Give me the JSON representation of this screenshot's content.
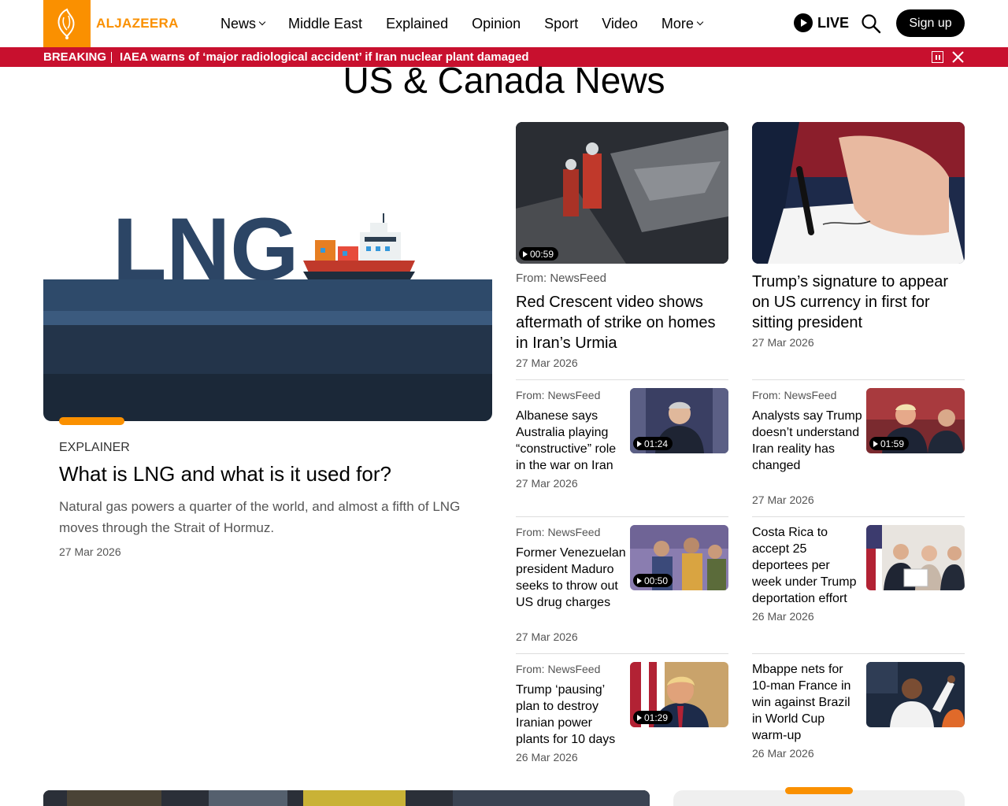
{
  "header": {
    "logo_text": "ALJAZEERA",
    "nav": [
      {
        "label": "News",
        "dropdown": true
      },
      {
        "label": "Middle East",
        "dropdown": false
      },
      {
        "label": "Explained",
        "dropdown": false
      },
      {
        "label": "Opinion",
        "dropdown": false
      },
      {
        "label": "Sport",
        "dropdown": false
      },
      {
        "label": "Video",
        "dropdown": false
      },
      {
        "label": "More",
        "dropdown": true
      }
    ],
    "live_label": "LIVE",
    "signup_label": "Sign up"
  },
  "breaking": {
    "label": "BREAKING",
    "text": "IAEA warns of ‘major radiological accident’ if Iran nuclear plant damaged"
  },
  "page_title": "US & Canada News",
  "featured": {
    "tag": "EXPLAINER",
    "title": "What is LNG and what is it used for?",
    "summary": "Natural gas powers a quarter of the world, and almost a fifth of LNG moves through the Strait of Hormuz.",
    "date": "27 Mar 2026",
    "image_text": "LNG"
  },
  "top_cards": [
    {
      "source": "From: NewsFeed",
      "title": "Red Crescent video shows aftermath of strike on homes in Iran’s Urmia",
      "date": "27 Mar 2026",
      "duration": "00:59"
    },
    {
      "source": "",
      "title": "Trump’s signature to appear on US currency in first for sitting president",
      "date": "27 Mar 2026",
      "duration": ""
    }
  ],
  "left_list": [
    {
      "source": "From: NewsFeed",
      "title": "Albanese says Australia playing “constructive” role in the war on Iran",
      "date": "27 Mar 2026",
      "duration": "01:24"
    },
    {
      "source": "From: NewsFeed",
      "title": "Former Venezuelan president Maduro seeks to throw out US drug charges",
      "date": "27 Mar 2026",
      "duration": "00:50"
    },
    {
      "source": "From: NewsFeed",
      "title": "Trump ‘pausing’ plan to destroy Iranian power plants for 10 days",
      "date": "26 Mar 2026",
      "duration": "01:29"
    }
  ],
  "right_list": [
    {
      "source": "From: NewsFeed",
      "title": "Analysts say Trump doesn’t understand Iran reality has changed",
      "date": "27 Mar 2026",
      "duration": "01:59"
    },
    {
      "source": "",
      "title": "Costa Rica to accept 25 deportees per week under Trump deportation effort",
      "date": "26 Mar 2026",
      "duration": ""
    },
    {
      "source": "",
      "title": "Mbappe nets for 10-man France in win against Brazil in World Cup warm-up",
      "date": "26 Mar 2026",
      "duration": ""
    }
  ],
  "colors": {
    "brand": "#fa9000",
    "breaking": "#c8102e"
  }
}
